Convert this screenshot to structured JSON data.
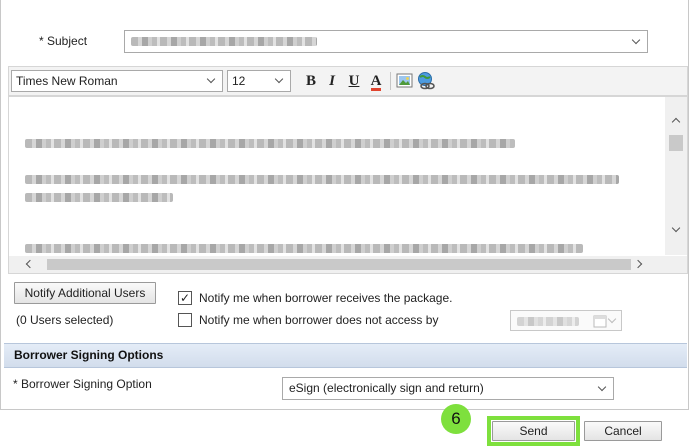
{
  "subject": {
    "label": "* Subject"
  },
  "toolbar": {
    "font_family": "Times New Roman",
    "font_size": "12",
    "bold_label": "B",
    "italic_label": "I",
    "underline_label": "U",
    "font_color_label": "A"
  },
  "notify": {
    "button_label": "Notify Additional Users",
    "users_selected": "(0 Users selected)",
    "receives_label": "Notify me when borrower receives the package.",
    "receives_checked": true,
    "not_access_label": "Notify me when borrower does not access by",
    "not_access_checked": false
  },
  "signing": {
    "section_title": "Borrower Signing Options",
    "option_label": "* Borrower Signing Option",
    "option_value": "eSign (electronically sign and return)"
  },
  "footer": {
    "step_number": "6",
    "send_label": "Send",
    "cancel_label": "Cancel"
  },
  "colors": {
    "highlight": "#7ee03d",
    "section_header": "#d9e3f0",
    "font_color_underline": "#e0442e"
  }
}
